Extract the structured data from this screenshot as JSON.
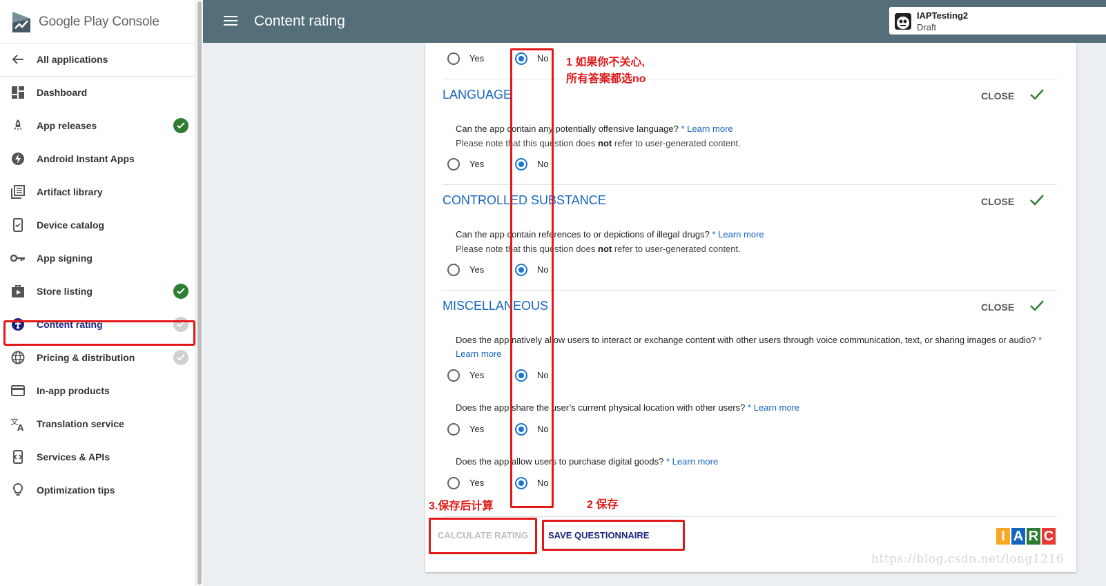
{
  "brand": {
    "name_a": "Google Play",
    "name_b": "Console"
  },
  "sidebar": {
    "back_label": "All applications",
    "items": [
      {
        "label": "Dashboard",
        "icon": "dashboard-icon",
        "status": "none"
      },
      {
        "label": "App releases",
        "icon": "rocket-icon",
        "status": "complete"
      },
      {
        "label": "Android Instant Apps",
        "icon": "bolt-icon",
        "status": "none"
      },
      {
        "label": "Artifact library",
        "icon": "library-icon",
        "status": "none"
      },
      {
        "label": "Device catalog",
        "icon": "device-icon",
        "status": "none"
      },
      {
        "label": "App signing",
        "icon": "key-icon",
        "status": "none"
      },
      {
        "label": "Store listing",
        "icon": "store-icon",
        "status": "complete"
      },
      {
        "label": "Content rating",
        "icon": "content-rating-icon",
        "status": "incomplete"
      },
      {
        "label": "Pricing & distribution",
        "icon": "globe-icon",
        "status": "incomplete"
      },
      {
        "label": "In-app products",
        "icon": "card-icon",
        "status": "none"
      },
      {
        "label": "Translation service",
        "icon": "translate-icon",
        "status": "none"
      },
      {
        "label": "Services & APIs",
        "icon": "api-icon",
        "status": "none"
      },
      {
        "label": "Optimization tips",
        "icon": "lightbulb-icon",
        "status": "none"
      }
    ]
  },
  "header": {
    "title": "Content rating",
    "app_name": "IAPTesting2",
    "app_status": "Draft"
  },
  "questionnaire": {
    "top_row": {
      "yes": "Yes",
      "no": "No",
      "selected": "No"
    },
    "sections": [
      {
        "title": "LANGUAGE",
        "close_label": "CLOSE",
        "questions": [
          {
            "text": "Can the app contain any potentially offensive language?",
            "required": "*",
            "learn_more": "Learn more",
            "note_a": "Please note that this question does",
            "note_b": "not",
            "note_c": "refer to user-generated content.",
            "yes": "Yes",
            "no": "No",
            "selected": "No"
          }
        ]
      },
      {
        "title": "CONTROLLED SUBSTANCE",
        "close_label": "CLOSE",
        "questions": [
          {
            "text": "Can the app contain references to or depictions of illegal drugs?",
            "required": "*",
            "learn_more": "Learn more",
            "note_a": "Please note that this question does",
            "note_b": "not",
            "note_c": "refer to user-generated content.",
            "yes": "Yes",
            "no": "No",
            "selected": "No"
          }
        ]
      },
      {
        "title": "MISCELLANEOUS",
        "close_label": "CLOSE",
        "questions": [
          {
            "text": "Does the app natively allow users to interact or exchange content with other users through voice communication, text, or sharing images or audio?",
            "required": "*",
            "learn_more": "Learn more",
            "yes": "Yes",
            "no": "No",
            "selected": "No"
          },
          {
            "text": "Does the app share the user’s current physical location with other users?",
            "required": "*",
            "learn_more": "Learn more",
            "yes": "Yes",
            "no": "No",
            "selected": "No"
          },
          {
            "text": "Does the app allow users to purchase digital goods?",
            "required": "*",
            "learn_more": "Learn more",
            "yes": "Yes",
            "no": "No",
            "selected": "No"
          }
        ]
      }
    ],
    "calculate_label": "CALCULATE RATING",
    "save_label": "SAVE QUESTIONNAIRE",
    "iarc_letters": [
      "I",
      "A",
      "R",
      "C"
    ],
    "iarc_colors": [
      "#f9a825",
      "#1565c0",
      "#2e7d32",
      "#e53935"
    ]
  },
  "annotations": {
    "note1_line1": "1 如果你不关心,",
    "note1_line2": "所有答案都选no",
    "note2": "2 保存",
    "note3": "3.保存后计算",
    "color": "#e21818"
  },
  "watermark": "https://blog.csdn.net/long1216"
}
